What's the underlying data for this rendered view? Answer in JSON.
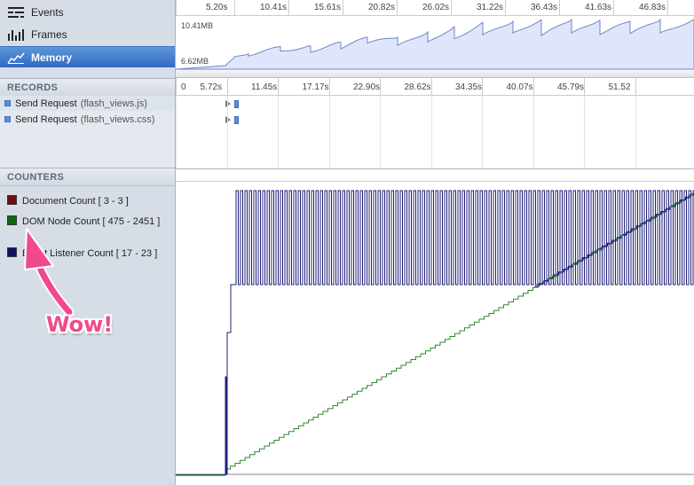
{
  "sidebar": {
    "nav": [
      {
        "label": "Events",
        "icon": "events-icon"
      },
      {
        "label": "Frames",
        "icon": "frames-icon"
      },
      {
        "label": "Memory",
        "icon": "memory-icon",
        "selected": true
      }
    ],
    "records_header": "RECORDS",
    "records": [
      {
        "name": "Send Request",
        "detail": "(flash_views.js)"
      },
      {
        "name": "Send Request",
        "detail": "(flash_views.css)"
      }
    ],
    "counters_header": "COUNTERS",
    "counters": [
      {
        "label": "Document Count [ 3 - 3 ]",
        "color": "#6b1010"
      },
      {
        "label": "DOM Node Count [ 475 - 2451 ]",
        "color": "#0b6b0b"
      },
      {
        "label": "Event Listener Count [ 17 - 23 ]",
        "color": "#10105e"
      }
    ]
  },
  "overview": {
    "ticks": [
      "5.20s",
      "10.41s",
      "15.61s",
      "20.82s",
      "26.02s",
      "31.22s",
      "36.43s",
      "41.63s",
      "46.83s"
    ],
    "memory_max": "10.41MB",
    "memory_min": "6.62MB"
  },
  "records_ruler": {
    "ticks": [
      "0",
      "5.72s",
      "11.45s",
      "17.17s",
      "22.90s",
      "28.62s",
      "34.35s",
      "40.07s",
      "45.79s",
      "51.52"
    ]
  },
  "annotation": {
    "text": "Wow!",
    "color": "#f04a8c"
  }
}
